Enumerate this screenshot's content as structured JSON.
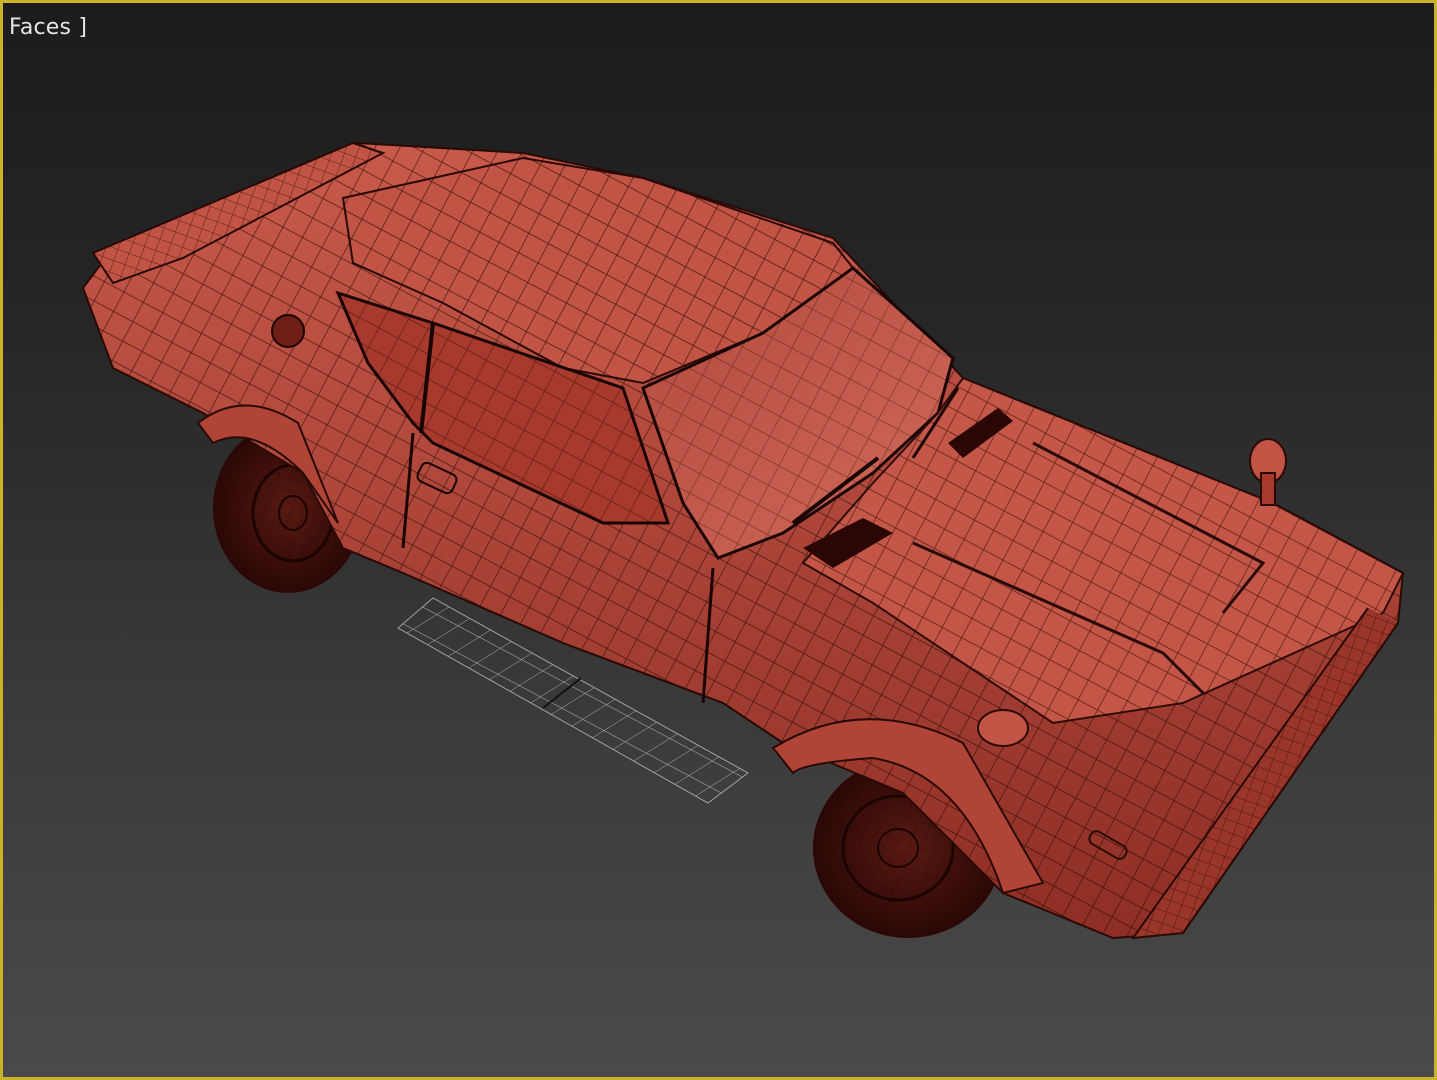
{
  "viewport": {
    "label": "Faces ]",
    "border_color": "#c8b42a",
    "background_top": "#1c1c1c",
    "background_bottom": "#4a4a4a"
  },
  "scene": {
    "object": "car-wireframe-model",
    "shading_mode": "faces",
    "mesh_color": "#b8473a",
    "wire_color": "#2a0a06",
    "grid_color": "#cfcfcf"
  }
}
